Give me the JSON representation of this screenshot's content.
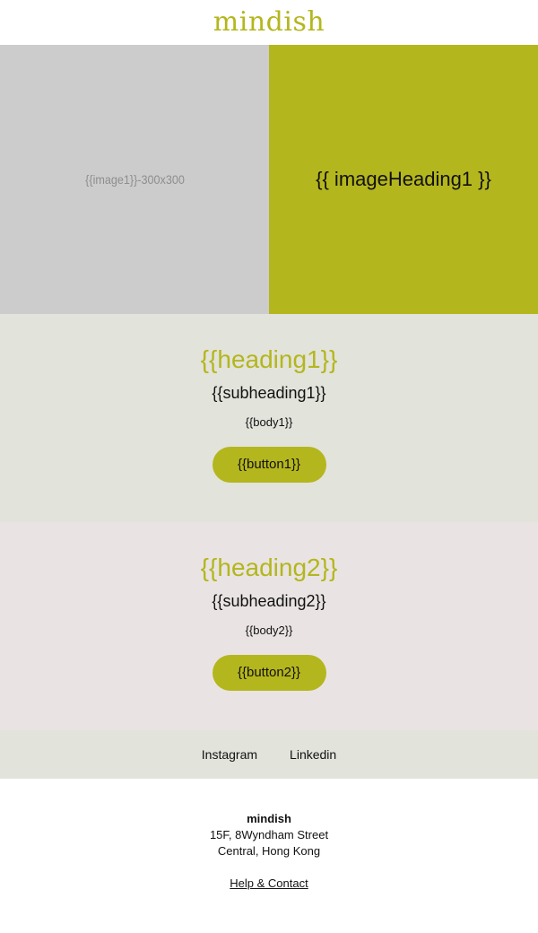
{
  "header": {
    "logo_text": "mindish"
  },
  "hero": {
    "image_placeholder": "{{image1}}-300x300",
    "image_heading": "{{ imageHeading1 }}"
  },
  "sections": [
    {
      "heading": "{{heading1}}",
      "subheading": "{{subheading1}}",
      "body": "{{body1}}",
      "button": "{{button1}}"
    },
    {
      "heading": "{{heading2}}",
      "subheading": "{{subheading2}}",
      "body": "{{body2}}",
      "button": "{{button2}}"
    }
  ],
  "social": {
    "links": [
      "Instagram",
      "Linkedin"
    ]
  },
  "footer": {
    "company": "mindish",
    "address_line1": "15F, 8Wyndham Street",
    "address_line2": "Central, Hong Kong",
    "help_link": "Help & Contact"
  },
  "colors": {
    "accent": "#b4b61d",
    "section1_bg": "#e2e3db",
    "section2_bg": "#e9e4e3",
    "image_placeholder_bg": "#cccccc"
  }
}
